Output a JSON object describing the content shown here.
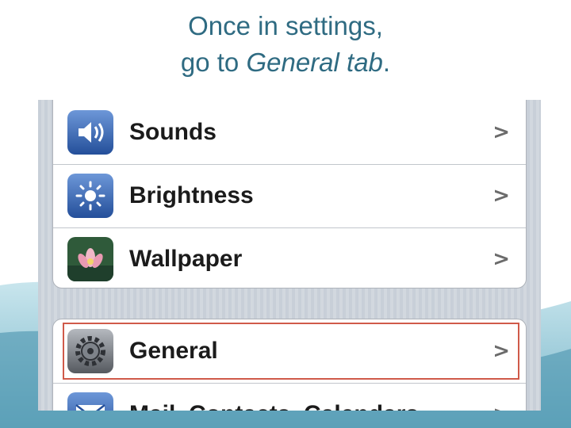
{
  "caption": {
    "line1": "Once in settings,",
    "line2_prefix": "go to ",
    "line2_emphasis": "General tab",
    "line2_suffix": "."
  },
  "settings": {
    "items": [
      {
        "label": "Sounds",
        "icon": "speaker-icon"
      },
      {
        "label": "Brightness",
        "icon": "sun-icon"
      },
      {
        "label": "Wallpaper",
        "icon": "flower-icon"
      },
      {
        "label": "General",
        "icon": "gear-icon",
        "highlighted": true
      },
      {
        "label": "Mail, Contacts, Calendars",
        "icon": "envelope-icon"
      }
    ],
    "chevron": ">"
  },
  "colors": {
    "caption": "#2f6b82",
    "highlight": "#d05a4a",
    "icon_blue": "#2f62b0"
  }
}
